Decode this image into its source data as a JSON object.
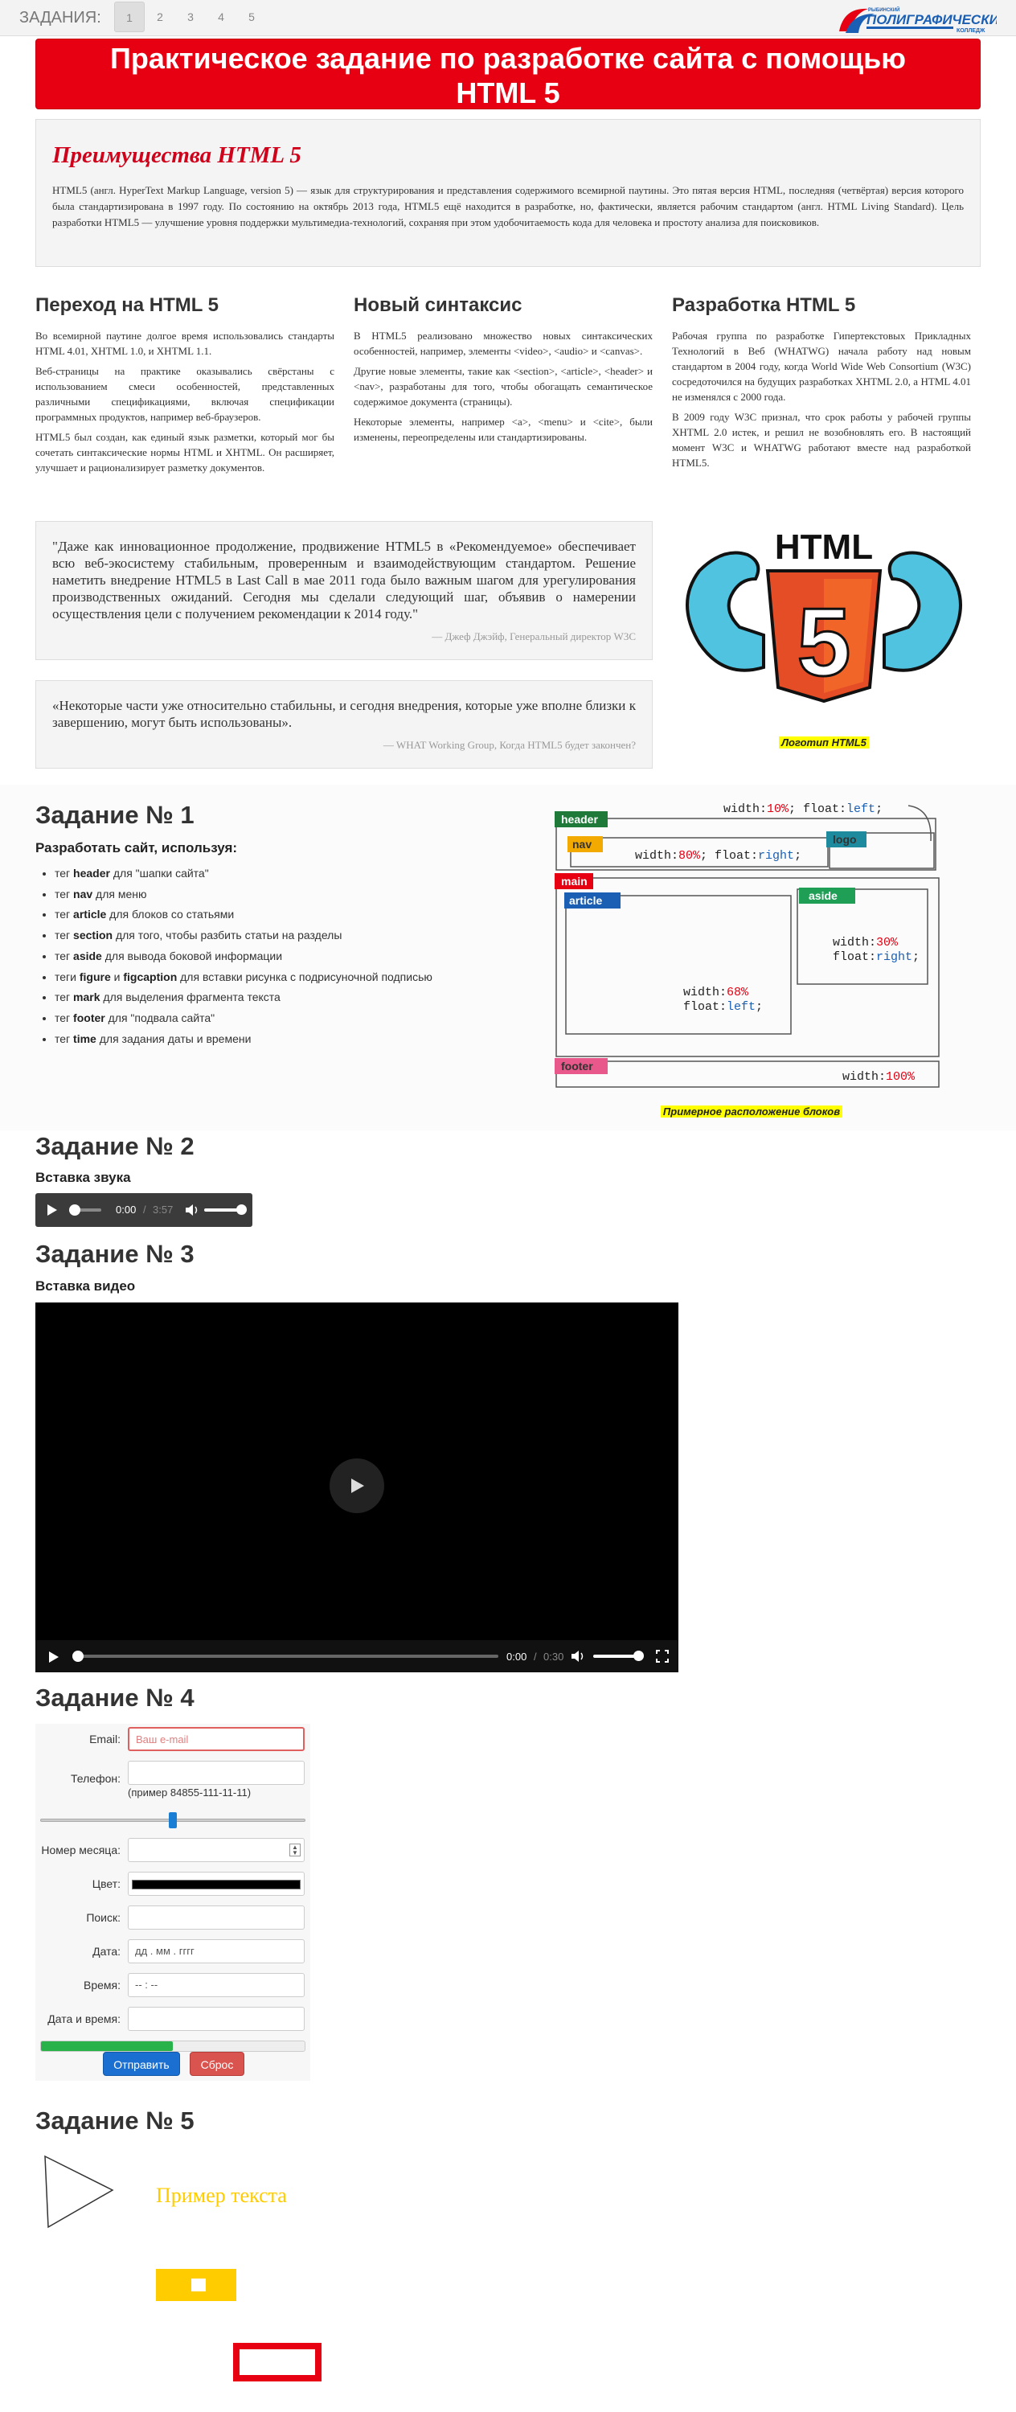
{
  "topbar": {
    "label": "ЗАДАНИЯ:",
    "pages": [
      "1",
      "2",
      "3",
      "4",
      "5"
    ],
    "active_page": "1",
    "logo_top": "РЫБИНСКИЙ",
    "logo_main": "ПОЛИГРАФИЧЕСКИЙ",
    "logo_bottom": "КОЛЛЕДЖ"
  },
  "header": {
    "title_line1": "Практическое задание по разработке сайта с помощью",
    "title_line2": "HTML 5"
  },
  "advantages": {
    "title": "Преимущества HTML 5",
    "text": "HTML5 (англ. HyperText Markup Language, version 5) — язык для структурирования и представления содержимого всемирной паутины. Это пятая версия HTML, последняя (четвёртая) версия которого была стандартизирована в 1997 году. По состоянию на октябрь 2013 года, HTML5 ещё находится в разработке, но, фактически, является рабочим стандартом (англ. HTML Living Standard). Цель разработки HTML5 — улучшение уровня поддержки мультимедиа-технологий, сохраняя при этом удобочитаемость кода для человека и простоту анализа для поисковиков."
  },
  "columns": [
    {
      "title": "Переход на HTML 5",
      "paras": [
        "Во всемирной паутине долгое время использовались стандарты HTML 4.01, XHTML 1.0, и XHTML 1.1.",
        "Веб-страницы на практике оказывались свёрстаны с использованием смеси особенностей, представленных различными спецификациями, включая спецификации программных продуктов, например веб-браузеров.",
        "HTML5 был создан, как единый язык разметки, который мог бы сочетать синтаксические нормы HTML и XHTML. Он расширяет, улучшает и рационализирует разметку документов."
      ]
    },
    {
      "title": "Новый синтаксис",
      "paras": [
        "В HTML5 реализовано множество новых синтаксических особенностей, например, элементы <video>, <audio> и <canvas>.",
        "Другие новые элементы, такие как <section>, <article>, <header> и <nav>, разработаны для того, чтобы обогащать семантическое содержимое документа (страницы).",
        "Некоторые элементы, например <a>, <menu> и <cite>, были изменены, переопределены или стандартизированы."
      ]
    },
    {
      "title": "Разработка HTML 5",
      "paras": [
        "Рабочая группа по разработке Гипертекстовых Прикладных Технологий в Веб (WHATWG) начала работу над новым стандартом в 2004 году, когда World Wide Web Consortium (W3C) сосредоточился на будущих разработках XHTML 2.0, а HTML 4.01 не изменялся с 2000 года.",
        "В 2009 году W3C признал, что срок работы у рабочей группы XHTML 2.0 истек, и решил не возобновлять его. В настоящий момент W3C и WHATWG работают вместе над разработкой HTML5."
      ]
    }
  ],
  "quotes": [
    {
      "text": "\"Даже как инновационное продолжение, продвижение HTML5 в «Рекомендуемое» обеспечивает всю веб-экосистему стабильным, проверенным и взаимодействующим стандартом. Решение наметить внедрение HTML5 в Last Call в мае 2011 года было важным шагом для урегулирования производственных ожиданий. Сегодня мы сделали следующий шаг, объявив о намерении осуществления цели с получением рекомендации к 2014 году.\"",
      "author": "— Джеф Джэйф, Генеральный директор W3C"
    },
    {
      "text": "«Некоторые части уже относительно стабильны, и сегодня внедрения, которые уже вполне близки к завершению, могут быть использованы».",
      "author": "— WHAT Working Group, Когда HTML5 будет закончен?"
    }
  ],
  "html5_logo": {
    "big_text": "HTML",
    "digit": "5",
    "caption": "Логотип HTML5"
  },
  "task1": {
    "title": "Задание № 1",
    "subtitle": "Разработать сайт, используя:",
    "items": [
      {
        "pre": "тег ",
        "b": "header",
        "post": " для \"шапки сайта\""
      },
      {
        "pre": "тег ",
        "b": "nav",
        "post": " для меню"
      },
      {
        "pre": "тег ",
        "b": "article",
        "post": " для блоков со статьями"
      },
      {
        "pre": "тег ",
        "b": "section",
        "post": " для того, чтобы разбить статьи на разделы"
      },
      {
        "pre": "тег ",
        "b": "aside",
        "post": " для вывода боковой информации"
      },
      {
        "pre": "теги ",
        "b": "figure",
        "mid": " и ",
        "b2": "figcaption",
        "post": " для вставки рисунка с подрисуночной подписью"
      },
      {
        "pre": "тег ",
        "b": "mark",
        "post": " для выделения фрагмента текста"
      },
      {
        "pre": "тег ",
        "b": "footer",
        "post": " для \"подвала сайта\""
      },
      {
        "pre": "тег ",
        "b": "time",
        "post": " для задания даты и времени"
      }
    ],
    "diagram": {
      "header": "header",
      "nav": "nav",
      "logo": "logo",
      "main": "main",
      "article": "article",
      "aside": "aside",
      "footer": "footer",
      "css_header": [
        "width:",
        "10%",
        "; float:",
        "left",
        ";"
      ],
      "css_nav": [
        "width:",
        "80%",
        "; float:",
        "right",
        ";"
      ],
      "css_article": [
        "width:",
        "68%",
        "float:",
        "left",
        ";"
      ],
      "css_aside": [
        "width:",
        "30%",
        "float:",
        "right",
        ";"
      ],
      "css_footer": [
        "width:",
        "100%"
      ],
      "caption": "Примерное расположение блоков"
    }
  },
  "task2": {
    "title": "Задание № 2",
    "subtitle": "Вставка звука",
    "time": "0:00",
    "duration": "3:57"
  },
  "task3": {
    "title": "Задание № 3",
    "subtitle": "Вставка видео",
    "time": "0:00",
    "duration": "0:30"
  },
  "task4": {
    "title": "Задание № 4",
    "email_label": "Email:",
    "email_placeholder": "Ваш e-mail",
    "phone_label": "Телефон:",
    "phone_hint": "(пример 84855-111-11-11)",
    "slider_value": 0.5,
    "month_label": "Номер месяца:",
    "color_label": "Цвет:",
    "color_value": "#000000",
    "search_label": "Поиск:",
    "date_label": "Дата:",
    "date_placeholder": "дд . мм . гггг",
    "time_label": "Время:",
    "time_placeholder": "-- : --",
    "datetime_label": "Дата и время:",
    "progress_value": 0.5,
    "submit": "Отправить",
    "reset": "Сброс"
  },
  "task5": {
    "title": "Задание № 5",
    "sample_text": "Пример текста"
  },
  "colors": {
    "accent_red": "#e60012",
    "link_red": "#d0021b",
    "yellow": "#ffcc00",
    "label_green": "#2e8b57"
  }
}
